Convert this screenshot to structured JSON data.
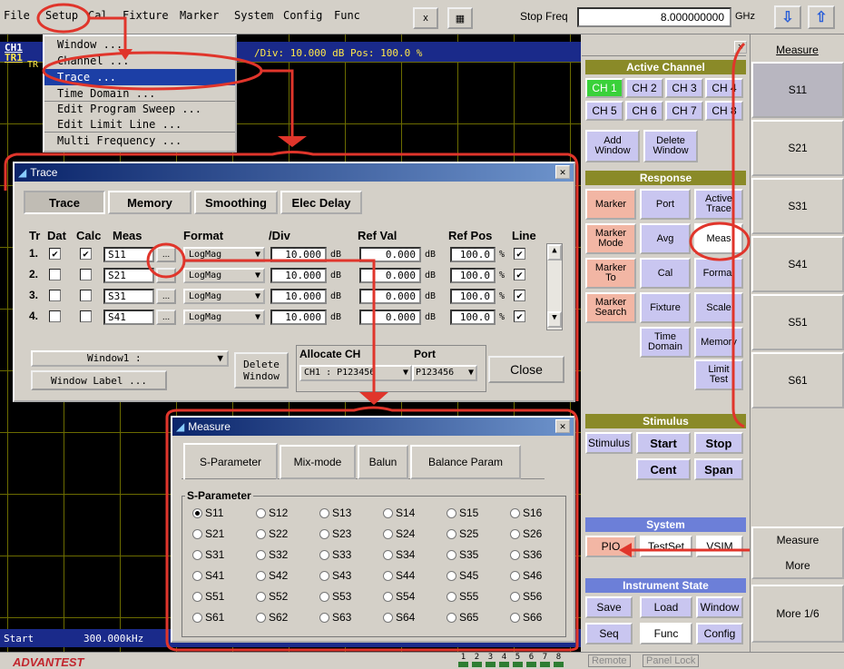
{
  "menu": {
    "items": [
      "File",
      "Setup",
      "Cal",
      "Fixture",
      "Marker",
      "System",
      "Config",
      "Func"
    ],
    "x_button": "x",
    "stop_freq_label": "Stop Freq",
    "stop_freq_value": "8.000000000",
    "unit": "GHz"
  },
  "trace_screen": {
    "channel": "CH1",
    "trace": "TR1",
    "trace_sub": "TR",
    "scale_info": "/Div: 10.000 dB   Pos: 100.0 %",
    "start_label": "Start",
    "start_value": "300.000kHz"
  },
  "setup_menu": {
    "items": [
      "Window ...",
      "Channel ...",
      "Trace ...",
      "Time Domain ...",
      "Edit Program Sweep ...",
      "Edit Limit Line ...",
      "Multi Frequency ..."
    ],
    "selected": "Trace ..."
  },
  "trace_dialog": {
    "title": "Trace",
    "tabs": [
      "Trace",
      "Memory",
      "Smoothing",
      "Elec Delay"
    ],
    "active_tab": "Trace",
    "headers": {
      "tr": "Tr",
      "dat": "Dat",
      "calc": "Calc",
      "meas": "Meas",
      "format": "Format",
      "div": "/Div",
      "ref_val": "Ref Val",
      "ref_pos": "Ref Pos",
      "line": "Line"
    },
    "rows": [
      {
        "tr": "1.",
        "dat": true,
        "calc": true,
        "meas": "S11",
        "format": "LogMag",
        "div": "10.000",
        "div_unit": "dB",
        "ref_val": "0.000",
        "ref_unit": "dB",
        "ref_pos": "100.0",
        "pos_unit": "%",
        "line": true
      },
      {
        "tr": "2.",
        "dat": false,
        "calc": false,
        "meas": "S21",
        "format": "LogMag",
        "div": "10.000",
        "div_unit": "dB",
        "ref_val": "0.000",
        "ref_unit": "dB",
        "ref_pos": "100.0",
        "pos_unit": "%",
        "line": true
      },
      {
        "tr": "3.",
        "dat": false,
        "calc": false,
        "meas": "S31",
        "format": "LogMag",
        "div": "10.000",
        "div_unit": "dB",
        "ref_val": "0.000",
        "ref_unit": "dB",
        "ref_pos": "100.0",
        "pos_unit": "%",
        "line": true
      },
      {
        "tr": "4.",
        "dat": false,
        "calc": false,
        "meas": "S41",
        "format": "LogMag",
        "div": "10.000",
        "div_unit": "dB",
        "ref_val": "0.000",
        "ref_unit": "dB",
        "ref_pos": "100.0",
        "pos_unit": "%",
        "line": true
      }
    ],
    "ellipsis": "...",
    "window_select": "Window1 :",
    "window_label_btn": "Window Label ...",
    "delete_window": "Delete\nWindow",
    "allocate_ch_label": "Allocate CH",
    "allocate_ch_value": "CH1 : P123456",
    "port_label": "Port",
    "port_value": "P123456",
    "close": "Close"
  },
  "measure_dialog": {
    "title": "Measure",
    "tabs": [
      "S-Parameter",
      "Mix-mode",
      "Balun",
      "Balance Param"
    ],
    "active_tab": "S-Parameter",
    "group_label": "S-Parameter",
    "params": [
      [
        "S11",
        "S12",
        "S13",
        "S14",
        "S15",
        "S16"
      ],
      [
        "S21",
        "S22",
        "S23",
        "S24",
        "S25",
        "S26"
      ],
      [
        "S31",
        "S32",
        "S33",
        "S34",
        "S35",
        "S36"
      ],
      [
        "S41",
        "S42",
        "S43",
        "S44",
        "S45",
        "S46"
      ],
      [
        "S51",
        "S52",
        "S53",
        "S54",
        "S55",
        "S56"
      ],
      [
        "S61",
        "S62",
        "S63",
        "S64",
        "S65",
        "S66"
      ]
    ],
    "selected": "S11"
  },
  "panel": {
    "active_channel": "Active Channel",
    "channels": [
      "CH 1",
      "CH 2",
      "CH 3",
      "CH 4",
      "CH 5",
      "CH 6",
      "CH 7",
      "CH 8"
    ],
    "add_window": "Add\nWindow",
    "delete_window": "Delete\nWindow",
    "response": "Response",
    "response_keys": [
      "Marker",
      "Port",
      "Active\nTrace",
      "Marker\nMode",
      "Avg",
      "Meas",
      "Marker\nTo",
      "Cal",
      "Format",
      "Marker\nSearch",
      "Fixture",
      "Scale",
      "Time\nDomain",
      "Memory",
      "Limit\nTest"
    ],
    "stimulus": "Stimulus",
    "stimulus_keys": [
      "Stimulus",
      "Start",
      "Stop",
      "Cent",
      "Span"
    ],
    "system": "System",
    "system_keys": [
      "PIO",
      "TestSet",
      "VSIM"
    ],
    "instrument_state": "Instrument State",
    "state_keys": [
      "Save",
      "Load",
      "Window",
      "Seq",
      "Func",
      "Config"
    ]
  },
  "softkeys": {
    "title": "Measure",
    "keys": [
      "S11",
      "S21",
      "S31",
      "S41",
      "S51",
      "S61"
    ],
    "measure_more_1": "Measure",
    "measure_more_2": "More",
    "more": "More 1/6"
  },
  "status": {
    "brand": "ADVANTEST",
    "ports": [
      "1",
      "2",
      "3",
      "4",
      "5",
      "6",
      "7",
      "8"
    ],
    "remote": "Remote",
    "panel_lock": "Panel Lock"
  },
  "colors": {
    "accent_red": "#e0352b",
    "title_blue": "#0a246a",
    "section_olive": "#8a8a28",
    "channel_green": "#3ad13a",
    "key_pink": "#f2b6a4",
    "key_lavender": "#c9c6f0",
    "state_blue": "#6c7fd8"
  }
}
